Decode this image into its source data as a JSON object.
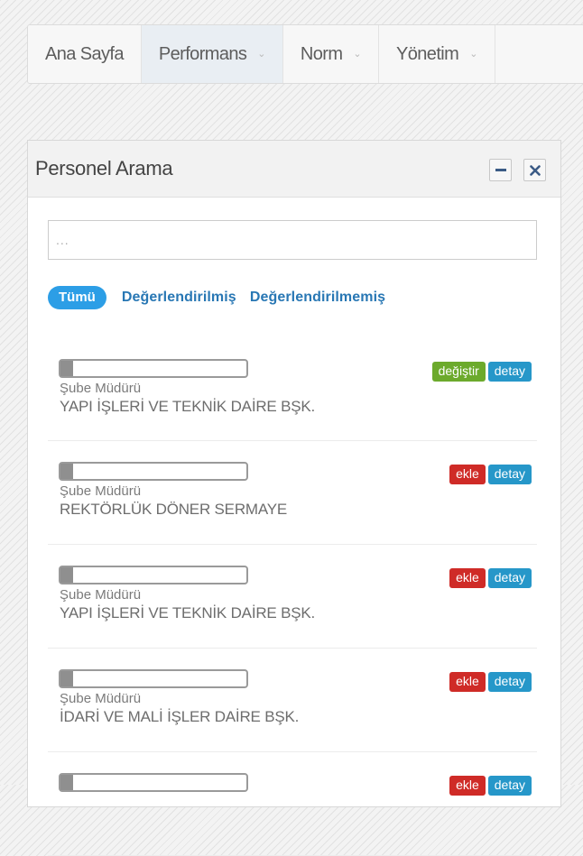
{
  "nav": {
    "items": [
      {
        "label": "Ana Sayfa",
        "has_dropdown": false,
        "active": false
      },
      {
        "label": "Performans",
        "has_dropdown": true,
        "active": true
      },
      {
        "label": "Norm",
        "has_dropdown": true,
        "active": false
      },
      {
        "label": "Yönetim",
        "has_dropdown": true,
        "active": false
      }
    ]
  },
  "panel": {
    "title": "Personel Arama",
    "minimize_symbol": "–",
    "close_symbol": "✕",
    "search": {
      "value": "",
      "placeholder": "..."
    },
    "filters": {
      "active": "Tümü",
      "links": [
        "Değerlendirilmiş",
        "Değerlendirilmemiş"
      ]
    },
    "people": [
      {
        "title": "Şube Müdürü",
        "department": "YAPI İŞLERİ VE TEKNİK DAİRE BŞK.",
        "action": "değiştir",
        "detail": "detay"
      },
      {
        "title": "Şube Müdürü",
        "department": "REKTÖRLÜK DÖNER SERMAYE",
        "action": "ekle",
        "detail": "detay"
      },
      {
        "title": "Şube Müdürü",
        "department": "YAPI İŞLERİ VE TEKNİK DAİRE BŞK.",
        "action": "ekle",
        "detail": "detay"
      },
      {
        "title": "Şube Müdürü",
        "department": "İDARİ VE MALİ İŞLER DAİRE BŞK.",
        "action": "ekle",
        "detail": "detay"
      },
      {
        "title": "",
        "department": "",
        "action": "ekle",
        "detail": "detay"
      }
    ]
  },
  "colors": {
    "accent_blue": "#2c9ee6",
    "link_blue": "#2877b4",
    "change_green": "#6caa2c",
    "add_red": "#cf2b27",
    "detail_blue": "#2697c9"
  }
}
